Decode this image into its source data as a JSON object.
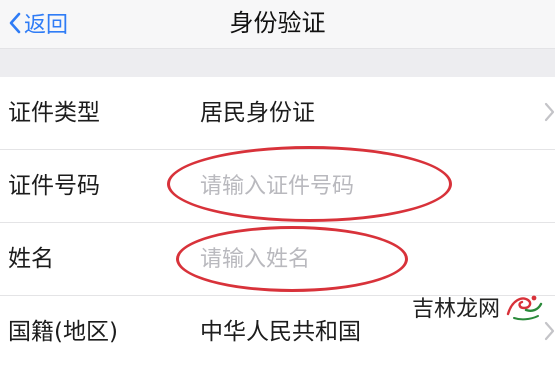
{
  "header": {
    "back_label": "返回",
    "title": "身份验证"
  },
  "form": {
    "rows": [
      {
        "label": "证件类型",
        "value": "居民身份证"
      },
      {
        "label": "证件号码",
        "placeholder": "请输入证件号码"
      },
      {
        "label": "姓名",
        "placeholder": "请输入姓名"
      },
      {
        "label": "国籍(地区)",
        "value": "中华人民共和国"
      }
    ]
  },
  "watermark": {
    "text": "吉林龙网"
  },
  "colors": {
    "accent": "#2f7cf6",
    "annotation": "#d8323a",
    "placeholder": "#b9b9be"
  },
  "icons": {
    "back": "chevron-left-icon",
    "disclosure": "chevron-right-icon"
  }
}
